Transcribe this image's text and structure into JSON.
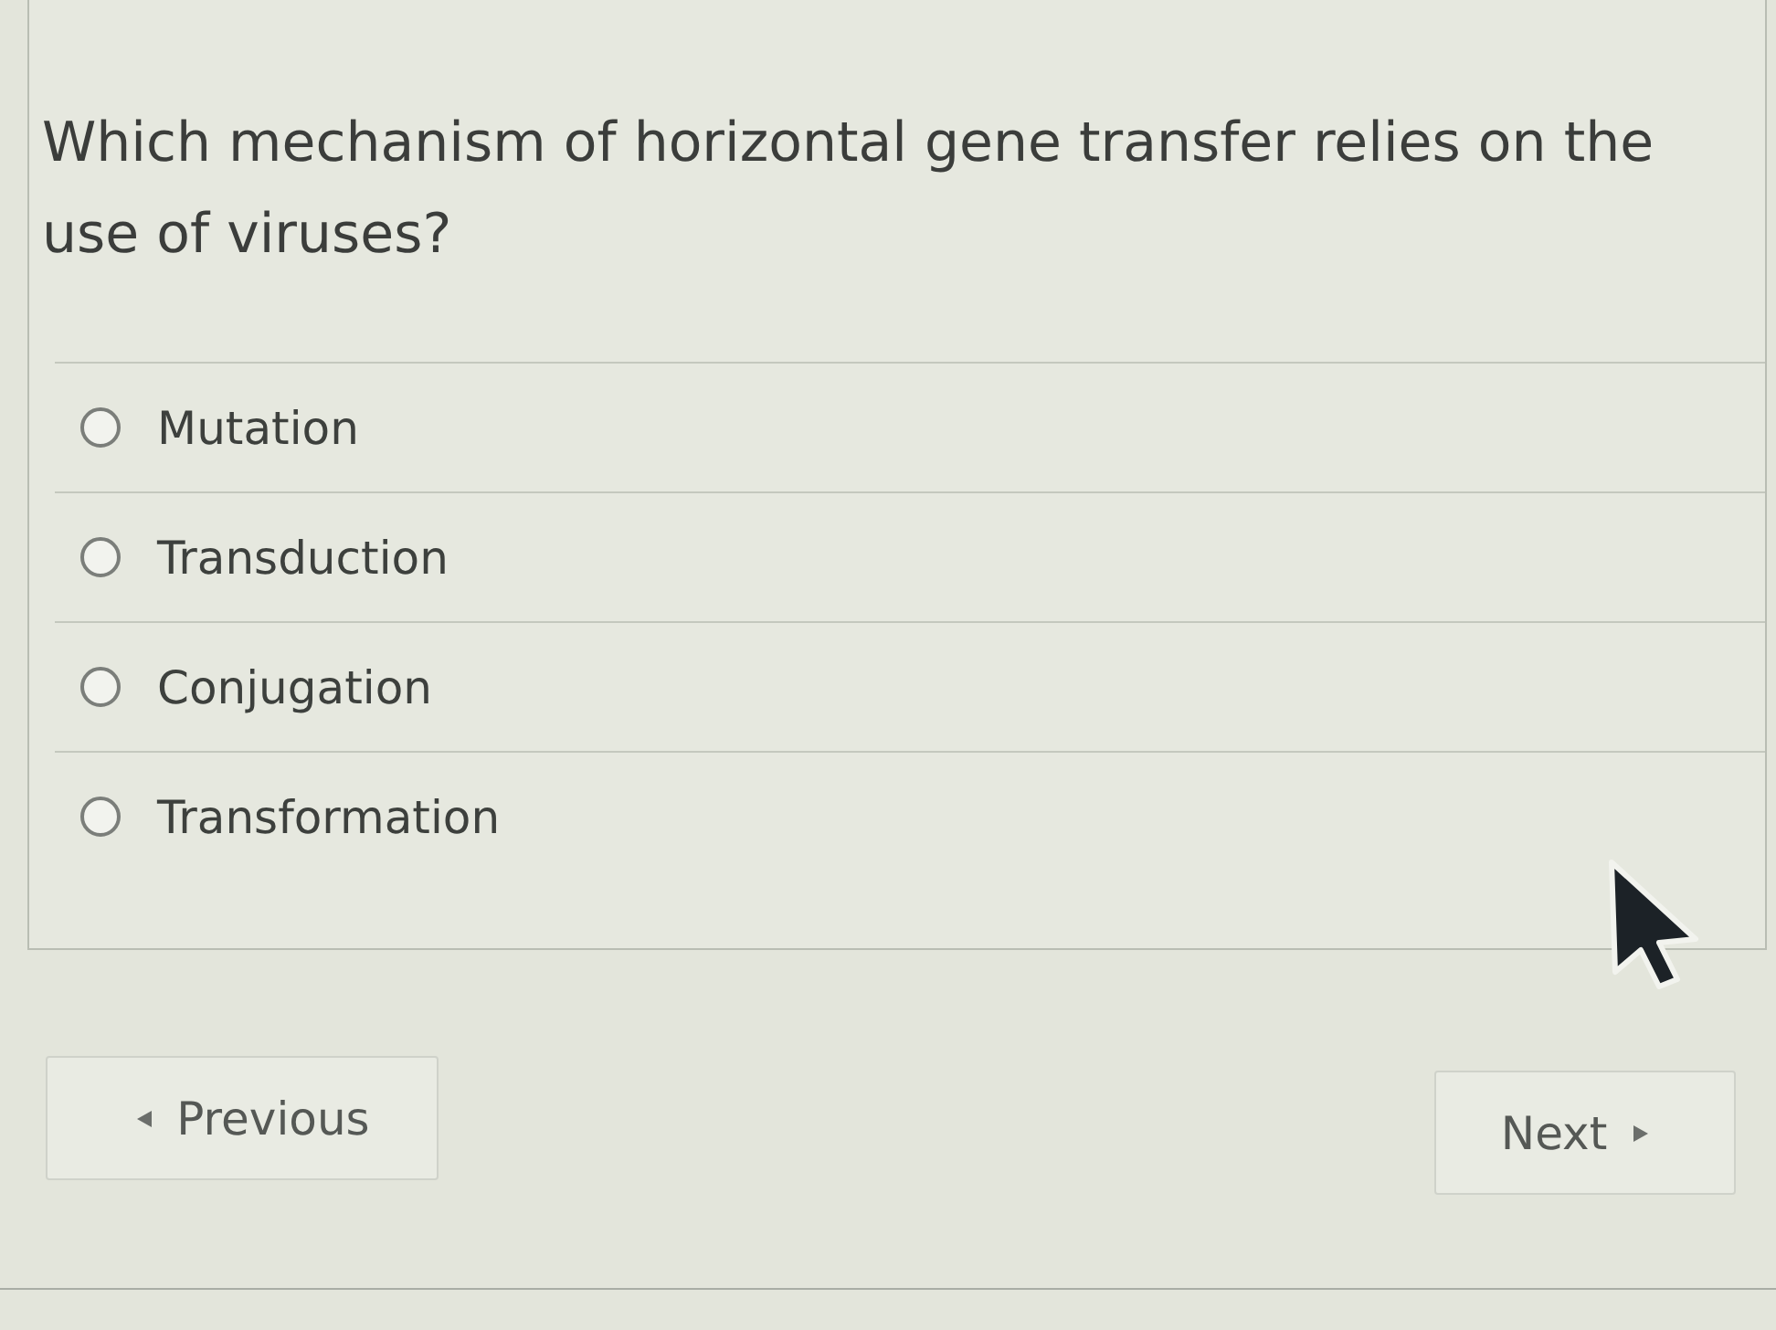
{
  "question": {
    "text": "Which mechanism of horizontal gene transfer relies on the use of viruses?"
  },
  "options": [
    {
      "label": "Mutation",
      "selected": false
    },
    {
      "label": "Transduction",
      "selected": false
    },
    {
      "label": "Conjugation",
      "selected": false
    },
    {
      "label": "Transformation",
      "selected": false
    }
  ],
  "navigation": [
    {
      "kind": "previous",
      "label": "Previous"
    },
    {
      "kind": "next",
      "label": "Next"
    }
  ]
}
